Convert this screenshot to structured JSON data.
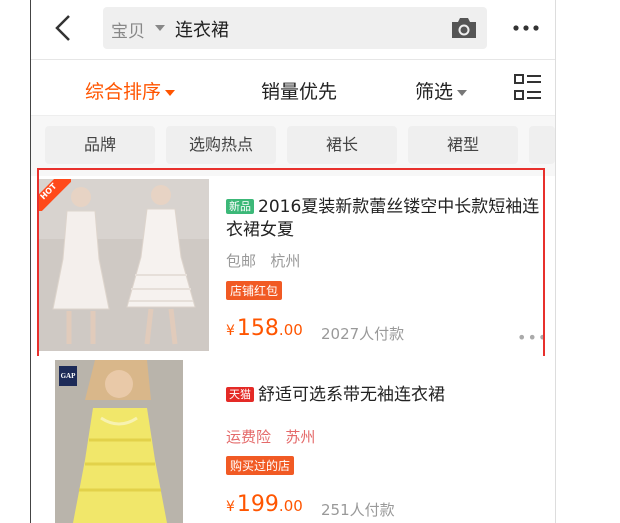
{
  "header": {
    "scope_label": "宝贝",
    "query": "连衣裙",
    "icons": [
      "back-arrow-icon",
      "camera-icon",
      "more-dots-icon"
    ]
  },
  "sortbar": {
    "items": [
      {
        "label": "综合排序",
        "active": true
      },
      {
        "label": "销量优先",
        "active": false
      },
      {
        "label": "筛选",
        "active": false
      }
    ],
    "view_toggle_icon": "list-view-icon"
  },
  "filters": {
    "chips": [
      "品牌",
      "选购热点",
      "裙长",
      "裙型"
    ]
  },
  "products": [
    {
      "badge": "新品",
      "title": "2016夏装新款蕾丝镂空中长款短袖连衣裙女夏",
      "shipping": "包邮",
      "location": "杭州",
      "tag": "店铺红包",
      "currency": "¥",
      "price_int": "158",
      "price_dec": ".00",
      "sold": "2027人付款",
      "corner_label": "HOT"
    },
    {
      "badge": "天猫",
      "title": "舒适可选系带无袖连衣裙",
      "shipping": "运费险",
      "location": "苏州",
      "tag": "购买过的店",
      "currency": "¥",
      "price_int": "199",
      "price_dec": ".00",
      "sold": "251人付款",
      "corner_label": "GAP"
    }
  ],
  "colors": {
    "accent": "#ff5500",
    "highlight_border": "#e8302c",
    "badge_new": "#3cb878",
    "badge_tmall": "#e42a26"
  }
}
